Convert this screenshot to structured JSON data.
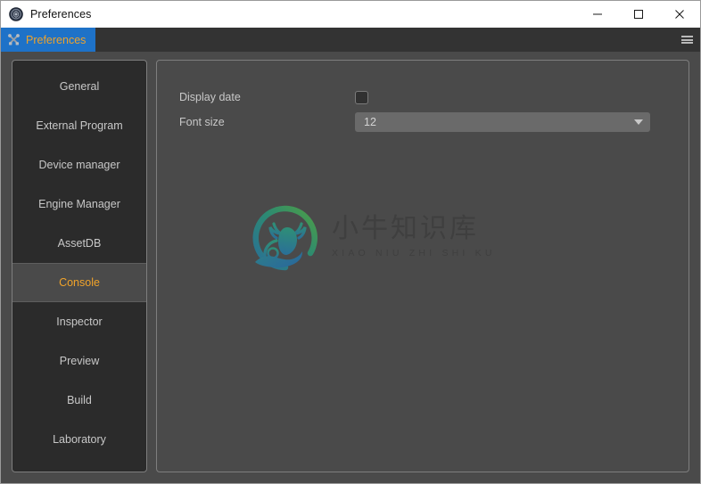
{
  "window": {
    "title": "Preferences",
    "icon": "app-logo-icon",
    "controls": [
      {
        "name": "minimize",
        "glyph": "minimize-icon"
      },
      {
        "name": "maximize",
        "glyph": "maximize-icon"
      },
      {
        "name": "close",
        "glyph": "close-icon"
      }
    ]
  },
  "tabbar": {
    "tabs": [
      {
        "label": "Preferences",
        "icon": "tools-icon",
        "active": true
      }
    ],
    "menu_icon": "hamburger-menu-icon"
  },
  "sidebar": {
    "items": [
      {
        "label": "General",
        "selected": false
      },
      {
        "label": "External Program",
        "selected": false
      },
      {
        "label": "Device manager",
        "selected": false
      },
      {
        "label": "Engine Manager",
        "selected": false
      },
      {
        "label": "AssetDB",
        "selected": false
      },
      {
        "label": "Console",
        "selected": true
      },
      {
        "label": "Inspector",
        "selected": false
      },
      {
        "label": "Preview",
        "selected": false
      },
      {
        "label": "Build",
        "selected": false
      },
      {
        "label": "Laboratory",
        "selected": false
      }
    ]
  },
  "content": {
    "fields": [
      {
        "label": "Display date",
        "type": "checkbox",
        "checked": false
      },
      {
        "label": "Font size",
        "type": "dropdown",
        "value": "12",
        "arrow_icon": "chevron-down-icon"
      }
    ]
  },
  "watermark": {
    "chinese": "小牛知识库",
    "pinyin": "XIAO NIU ZHI SHI KU",
    "mark_icon": "ox-in-circle-logo-icon"
  },
  "colors": {
    "titlebar_bg": "#ffffff",
    "tabbar_bg": "#333333",
    "tab_active_bg": "#1e72c8",
    "tab_active_text": "#f0a32a",
    "sidebar_bg": "#2b2b2b",
    "panel_bg": "#4a4a4a",
    "border": "#7e7e7e",
    "text": "#c8c8c8",
    "accent": "#f0a32a",
    "dropdown_bg": "#6a6a6a"
  }
}
